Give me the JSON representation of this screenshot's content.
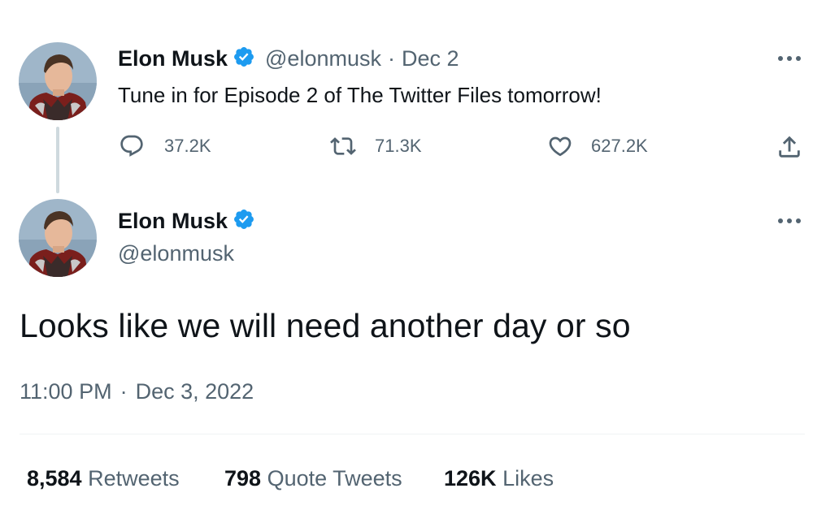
{
  "colors": {
    "text": "#0f1419",
    "secondary": "#536471",
    "verified": "#1d9bf0",
    "divider": "#eff3f4",
    "thread_line": "#cfd9de"
  },
  "tweet1": {
    "author_name": "Elon Musk",
    "handle": "@elonmusk",
    "separator": "·",
    "date": "Dec 2",
    "text": "Tune in for Episode 2 of The Twitter Files tomorrow!",
    "actions": {
      "reply_icon": "reply-icon",
      "reply_count": "37.2K",
      "retweet_icon": "retweet-icon",
      "retweet_count": "71.3K",
      "like_icon": "heart-icon",
      "like_count": "627.2K",
      "share_icon": "share-icon"
    }
  },
  "tweet2": {
    "author_name": "Elon Musk",
    "handle": "@elonmusk",
    "text": "Looks like we will need another day or so",
    "time": "11:00 PM",
    "separator": "·",
    "date": "Dec 3, 2022",
    "stats": {
      "retweets_value": "8,584",
      "retweets_label": "Retweets",
      "quote_value": "798",
      "quote_label": "Quote Tweets",
      "likes_value": "126K",
      "likes_label": "Likes"
    }
  }
}
